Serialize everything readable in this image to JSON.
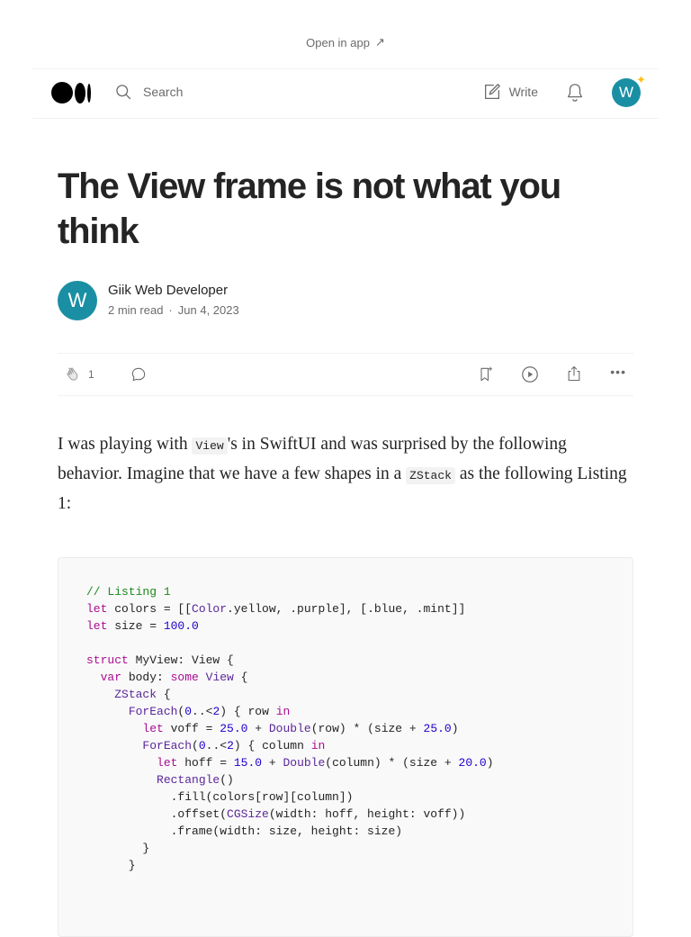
{
  "topbar": {
    "open_in_app": "Open in app",
    "arrow": "↗"
  },
  "nav": {
    "search_label": "Search",
    "write_label": "Write",
    "avatar_initial": "W",
    "avatar_badge": "✦"
  },
  "article": {
    "title": "The View frame is not what you think",
    "author": {
      "initial": "W",
      "name": "Giik Web Developer",
      "read_time": "2 min read",
      "separator": "·",
      "date": "Jun 4, 2023"
    },
    "actions": {
      "clap_count": "1",
      "more": "•••"
    },
    "paragraph": {
      "p1": "I was playing with ",
      "code1": "View",
      "p2": "'s in SwiftUI and was surprised by the following behavior. Imagine that we have a few shapes in a ",
      "code2": "ZStack",
      "p3": " as the following Listing 1:"
    }
  },
  "code_lines": [
    "// Listing 1",
    "let colors = [[Color.yellow, .purple], [.blue, .mint]]",
    "let size = 100.0",
    "",
    "struct MyView: View {",
    "  var body: some View {",
    "    ZStack {",
    "      ForEach(0..<2) { row in",
    "        let voff = 25.0 + Double(row) * (size + 25.0)",
    "        ForEach(0..<2) { column in",
    "          let hoff = 15.0 + Double(column) * (size + 20.0)",
    "          Rectangle()",
    "            .fill(colors[row][column])",
    "            .offset(CGSize(width: hoff, height: voff))",
    "            .frame(width: size, height: size)",
    "        }",
    "      }"
  ],
  "colors": {
    "accent": "#1a8fa4",
    "badge": "#ffc017",
    "comment": "#1c8a1c",
    "keyword": "#aa0d91",
    "number": "#1c00cf",
    "type": "#5c2699"
  }
}
